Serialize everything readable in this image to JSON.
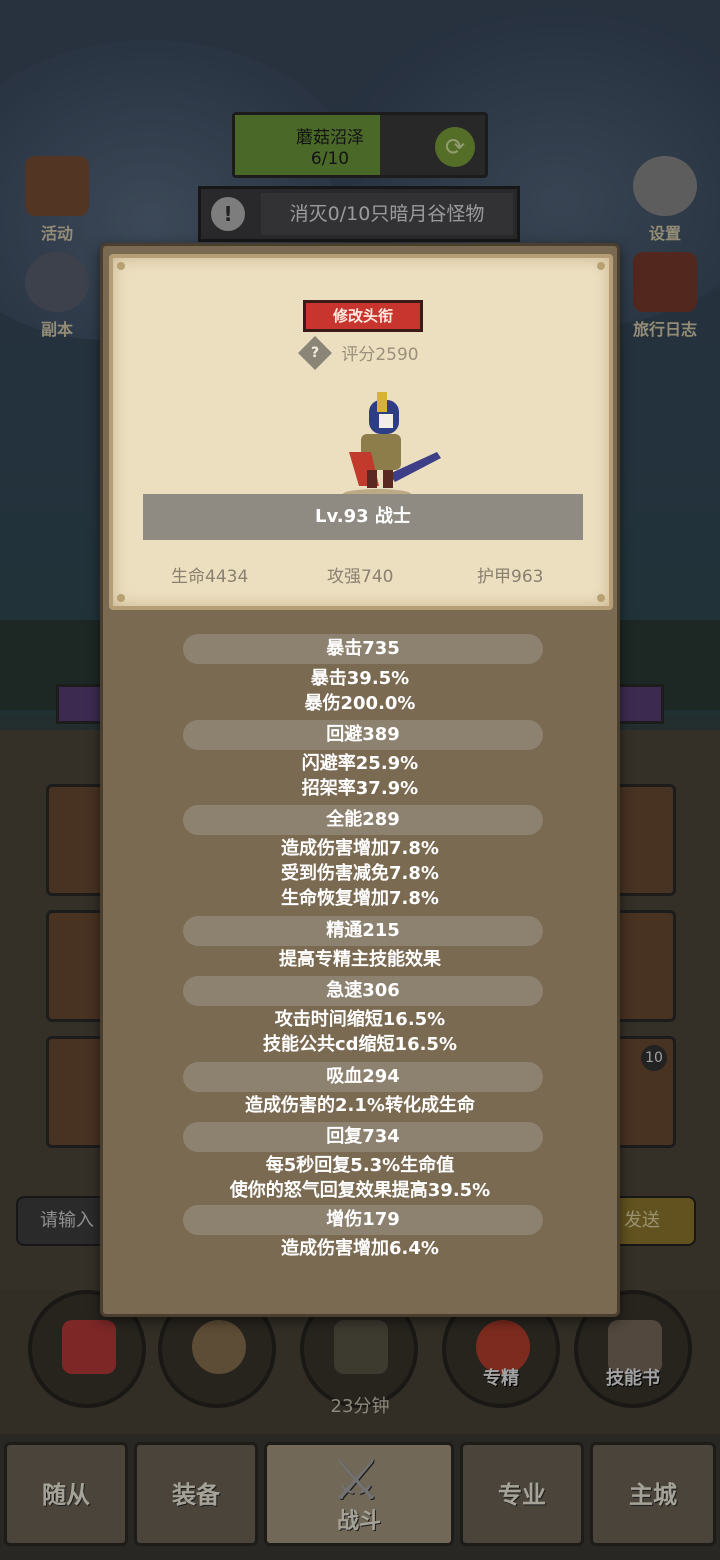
{
  "background": {
    "map_name": "蘑菇沼泽",
    "map_progress": "6/10",
    "quest_text": "消灭0/10只暗月谷怪物",
    "quest_info_glyph": "!",
    "left_buttons": [
      {
        "label": "活动",
        "icon": "activity-icon"
      },
      {
        "label": "副本",
        "icon": "dungeon-icon"
      }
    ],
    "right_buttons": [
      {
        "label": "设置",
        "icon": "gear-icon"
      },
      {
        "label": "旅行日志",
        "icon": "journal-icon"
      }
    ],
    "chat_placeholder": "请输入",
    "send_label": "发送",
    "card_badge": "10",
    "action_buttons": [
      {
        "label": "",
        "icon": "potion-icon"
      },
      {
        "label": "",
        "icon": "bread-icon"
      },
      {
        "label": "",
        "icon": "chest-icon"
      },
      {
        "label": "专精",
        "icon": "specialization-icon"
      },
      {
        "label": "技能书",
        "icon": "skill-book-icon"
      }
    ],
    "timer": "23分钟",
    "tabs": [
      {
        "label": "随从"
      },
      {
        "label": "装备"
      },
      {
        "label": "战斗",
        "active": true
      },
      {
        "label": "专业"
      },
      {
        "label": "主城"
      }
    ]
  },
  "character": {
    "edit_title_label": "修改头衔",
    "score_icon": "?",
    "score": "评分2590",
    "name_level": "Lv.93 战士",
    "hp": "生命4434",
    "attack": "攻强740",
    "armor": "护甲963"
  },
  "stats": [
    {
      "title": "暴击735",
      "lines": [
        "暴击39.5%",
        "暴伤200.0%"
      ]
    },
    {
      "title": "回避389",
      "lines": [
        "闪避率25.9%",
        "招架率37.9%"
      ]
    },
    {
      "title": "全能289",
      "lines": [
        "造成伤害增加7.8%",
        "受到伤害减免7.8%",
        "生命恢复增加7.8%"
      ]
    },
    {
      "title": "精通215",
      "lines": [
        "提高专精主技能效果"
      ]
    },
    {
      "title": "急速306",
      "lines": [
        "攻击时间缩短16.5%",
        "技能公共cd缩短16.5%"
      ]
    },
    {
      "title": "吸血294",
      "lines": [
        "造成伤害的2.1%转化成生命"
      ]
    },
    {
      "title": "回复734",
      "lines": [
        "每5秒回复5.3%生命值",
        "使你的怒气回复效果提高39.5%"
      ]
    },
    {
      "title": "增伤179",
      "lines": [
        "造成伤害增加6.4%"
      ]
    }
  ],
  "colors": {
    "modal_bg": "#7b6a52",
    "card_bg": "#ecdfc0",
    "title_button": "#c8352f",
    "stat_pill": "#8d8170"
  }
}
